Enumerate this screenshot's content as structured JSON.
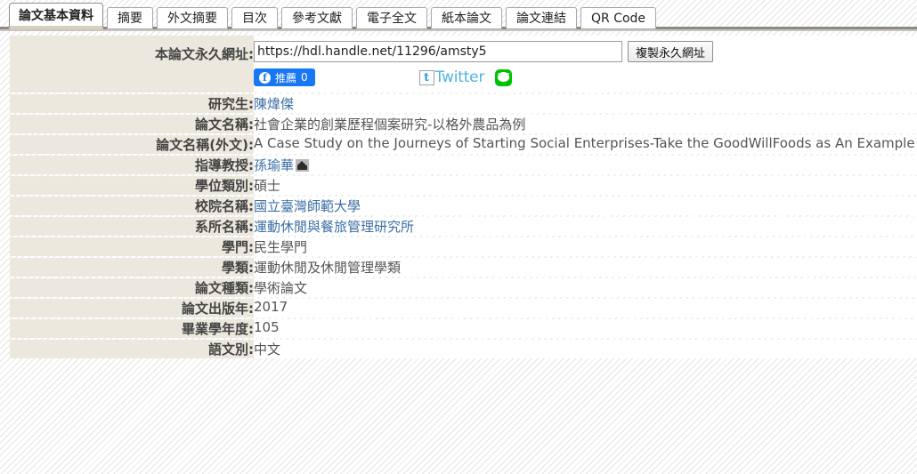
{
  "tabs": [
    {
      "label": "論文基本資料",
      "active": true
    },
    {
      "label": "摘要",
      "active": false
    },
    {
      "label": "外文摘要",
      "active": false
    },
    {
      "label": "目次",
      "active": false
    },
    {
      "label": "參考文獻",
      "active": false
    },
    {
      "label": "電子全文",
      "active": false
    },
    {
      "label": "紙本論文",
      "active": false
    },
    {
      "label": "論文連結",
      "active": false
    },
    {
      "label": "QR Code",
      "active": false
    }
  ],
  "permalink": {
    "label": "本論文永久網址:",
    "url_value": "https://hdl.handle.net/11296/amsty5",
    "copy_button": "複製永久網址",
    "facebook_label": "推薦",
    "facebook_count": "0",
    "twitter_label": "Twitter",
    "twitter_glyph": "t",
    "line_label": "LINE"
  },
  "fields": [
    {
      "label": "研究生:",
      "value": "陳煒傑",
      "link": true
    },
    {
      "label": "論文名稱:",
      "value": "社會企業的創業歷程個案研究-以格外農品為例",
      "link": false
    },
    {
      "label": "論文名稱(外文):",
      "value": "A Case Study on the Journeys of Starting Social Enterprises-Take the GoodWillFoods as An Example",
      "link": false
    },
    {
      "label": "指導教授:",
      "value": "孫瑜華",
      "link": true,
      "icon": "institution-icon"
    },
    {
      "label": "學位類別:",
      "value": "碩士",
      "link": false
    },
    {
      "label": "校院名稱:",
      "value": "國立臺灣師範大學",
      "link": true
    },
    {
      "label": "系所名稱:",
      "value": "運動休閒與餐旅管理研究所",
      "link": true
    },
    {
      "label": "學門:",
      "value": "民生學門",
      "link": false
    },
    {
      "label": "學類:",
      "value": "運動休閒及休閒管理學類",
      "link": false
    },
    {
      "label": "論文種類:",
      "value": "學術論文",
      "link": false
    },
    {
      "label": "論文出版年:",
      "value": "2017",
      "link": false
    },
    {
      "label": "畢業學年度:",
      "value": "105",
      "link": false
    },
    {
      "label": "語文別:",
      "value": "中文",
      "link": false
    }
  ],
  "colors": {
    "label_bg": "#ece8dd",
    "link": "#3b6ea5",
    "accent_tab_underline": "#d8d0bd",
    "facebook": "#1877f2",
    "line": "#00c300",
    "twitter": "#4fb3e0"
  }
}
